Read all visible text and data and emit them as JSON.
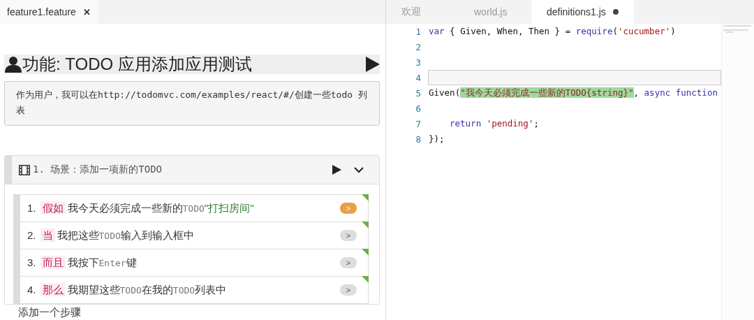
{
  "left_pane": {
    "tabs": [
      {
        "label": "feature1.feature",
        "close": "✕",
        "selected": true
      }
    ],
    "feature": {
      "title": "功能: TODO 应用添加应用测试",
      "description": "作为用户，我可以在http://todomvc.com/examples/react/#/创建一些todo 列表"
    },
    "scenario": {
      "title": "1. 场景：添加一项新的TODO",
      "expanded": true,
      "steps": [
        {
          "number": "1.",
          "keyword": "假如",
          "run": ">",
          "current": true,
          "parts": [
            {
              "text": "我今天必须完成一些新的",
              "kind": "plain"
            },
            {
              "text": "TODO",
              "kind": "mono"
            },
            {
              "text": "\"打扫房间\"",
              "kind": "string"
            }
          ]
        },
        {
          "number": "2.",
          "keyword": "当",
          "run": ">",
          "current": false,
          "parts": [
            {
              "text": "我把这些",
              "kind": "plain"
            },
            {
              "text": "TODO",
              "kind": "mono"
            },
            {
              "text": "输入到输入框中",
              "kind": "plain"
            }
          ]
        },
        {
          "number": "3.",
          "keyword": "而且",
          "run": ">",
          "current": false,
          "parts": [
            {
              "text": "我按下",
              "kind": "plain"
            },
            {
              "text": "Enter",
              "kind": "mono"
            },
            {
              "text": "键",
              "kind": "plain"
            }
          ]
        },
        {
          "number": "4.",
          "keyword": "那么",
          "run": ">",
          "current": false,
          "parts": [
            {
              "text": "我期望这些",
              "kind": "plain"
            },
            {
              "text": "TODO",
              "kind": "mono"
            },
            {
              "text": "在我的",
              "kind": "plain"
            },
            {
              "text": "TODO",
              "kind": "mono"
            },
            {
              "text": "列表中",
              "kind": "plain"
            }
          ]
        }
      ],
      "add_step": "添加一个步骤"
    }
  },
  "right_pane": {
    "tabs": [
      {
        "label": "欢迎",
        "modified": false,
        "selected": false
      },
      {
        "label": "world.js",
        "modified": false,
        "selected": false
      },
      {
        "label": "definitions1.js",
        "modified": true,
        "selected": true
      }
    ],
    "code_lines": [
      {
        "number": "1",
        "current": false,
        "tokens": [
          {
            "text": "var",
            "kind": "keyword"
          },
          {
            "text": " { Given, When, Then } = ",
            "kind": "plain"
          },
          {
            "text": "require",
            "kind": "keyword"
          },
          {
            "text": "(",
            "kind": "plain"
          },
          {
            "text": "'cucumber'",
            "kind": "string"
          },
          {
            "text": ")",
            "kind": "plain"
          }
        ]
      },
      {
        "number": "2",
        "current": false
      },
      {
        "number": "3",
        "current": false
      },
      {
        "number": "4",
        "current": true
      },
      {
        "number": "5",
        "current": false,
        "tokens": [
          {
            "text": "Given(",
            "kind": "plain"
          },
          {
            "text": "\"我今天必须完成一些新的TODO{string}\"",
            "kind": "match"
          },
          {
            "text": ", ",
            "kind": "plain"
          },
          {
            "text": "async function",
            "kind": "keyword"
          }
        ]
      },
      {
        "number": "6",
        "current": false
      },
      {
        "number": "7",
        "current": false,
        "indented": true,
        "tokens": [
          {
            "text": "return",
            "kind": "keyword"
          },
          {
            "text": " 'pending'",
            "kind": "string"
          },
          {
            "text": ";",
            "kind": "plain"
          }
        ]
      },
      {
        "number": "8",
        "current": false,
        "tokens": [
          {
            "text": "});",
            "kind": "plain"
          }
        ]
      }
    ]
  }
}
